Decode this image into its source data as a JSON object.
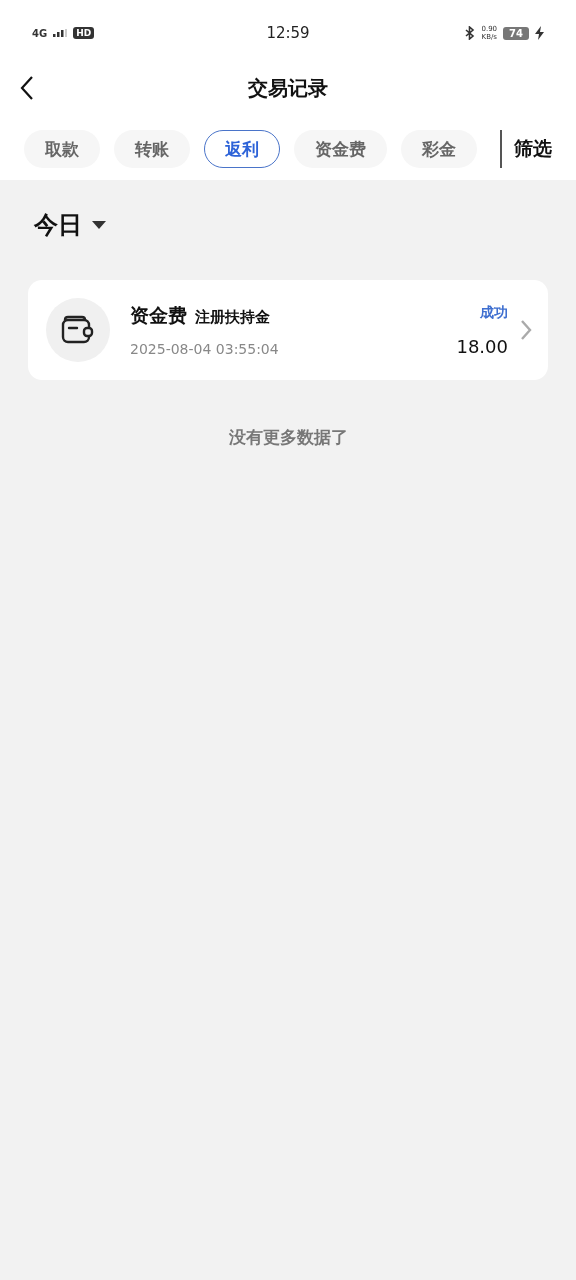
{
  "status_bar": {
    "network": "4G",
    "hd": "HD",
    "time": "12:59",
    "speed": "0.90",
    "speed_unit": "KB/s",
    "battery": "74"
  },
  "header": {
    "title": "交易记录"
  },
  "tabs": [
    {
      "label": "取款",
      "selected": false
    },
    {
      "label": "转账",
      "selected": false
    },
    {
      "label": "返利",
      "selected": true
    },
    {
      "label": "资金费",
      "selected": false
    },
    {
      "label": "彩金",
      "selected": false
    }
  ],
  "filter_button": "筛选",
  "date_filter": {
    "label": "今日"
  },
  "records": [
    {
      "title": "资金费",
      "subtitle": "注册扶持金",
      "time": "2025-08-04 03:55:04",
      "status": "成功",
      "amount": "18.00"
    }
  ],
  "footer": "没有更多数据了"
}
